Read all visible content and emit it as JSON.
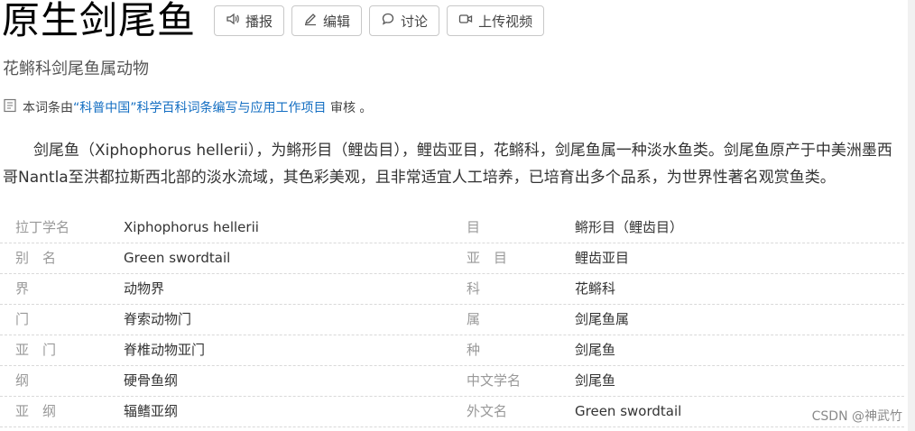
{
  "entry": {
    "title": "原生剑尾鱼",
    "subtitle": "花鳉科剑尾鱼属动物"
  },
  "toolbar": {
    "play_label": "播报",
    "edit_label": "编辑",
    "discuss_label": "讨论",
    "upload_label": "上传视频"
  },
  "audit": {
    "prefix": "本词条由",
    "link": "“科普中国”科学百科词条编写与应用工作项目",
    "suffix": "审核 。"
  },
  "intro": "剑尾鱼（Xiphophorus hellerii），为鳉形目（鲤齿目），鲤齿亚目，花鳉科，剑尾鱼属一种淡水鱼类。剑尾鱼原产于中美洲墨西哥Nantla至洪都拉斯西北部的淡水流域，其色彩美观，且非常适宜人工培养，已培育出多个品系，为世界性著名观赏鱼类。",
  "info_rows": [
    {
      "k1": "拉丁学名",
      "v1": "Xiphophorus hellerii",
      "k2": "目",
      "v2": "鳉形目（鲤齿目）"
    },
    {
      "k1": "别　名",
      "v1": "Green swordtail",
      "k2": "亚　目",
      "v2": "鲤齿亚目"
    },
    {
      "k1": "界",
      "v1": "动物界",
      "k2": "科",
      "v2": "花鳉科"
    },
    {
      "k1": "门",
      "v1": "脊索动物门",
      "k2": "属",
      "v2": "剑尾鱼属"
    },
    {
      "k1": "亚　门",
      "v1": "脊椎动物亚门",
      "k2": "种",
      "v2": "剑尾鱼"
    },
    {
      "k1": "纲",
      "v1": "硬骨鱼纲",
      "k2": "中文学名",
      "v2": "剑尾鱼"
    },
    {
      "k1": "亚　纲",
      "v1": "辐鳍亚纲",
      "k2": "外文名",
      "v2": "Green swordtail"
    }
  ],
  "watermark": "CSDN @神武竹"
}
